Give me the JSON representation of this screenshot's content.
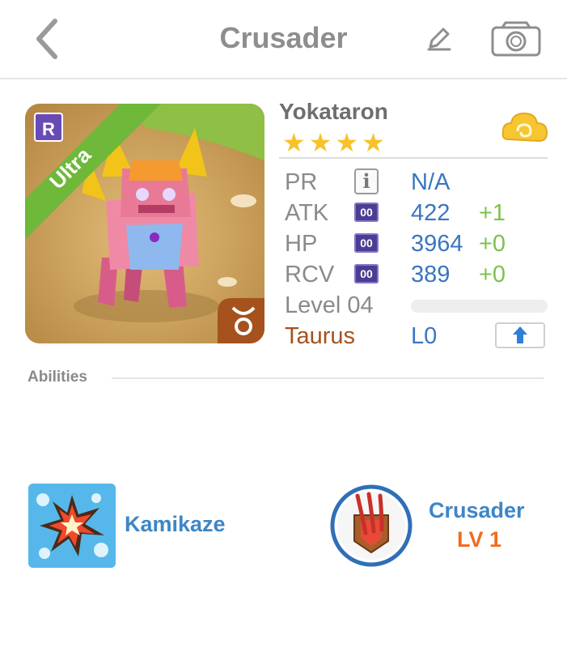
{
  "header": {
    "title": "Crusader",
    "back_icon": "chevron-left-icon",
    "edit_icon": "pencil-icon",
    "camera_icon": "camera-icon"
  },
  "monster": {
    "name": "Yokataron",
    "rarity_label": "Ultra",
    "rarity_badge": "R",
    "star_count": 4,
    "stars": "★★★★",
    "element_icon": "cloud-icon",
    "zodiac_icon": "taurus-icon"
  },
  "stats": {
    "pr": {
      "label": "PR",
      "badge": "i",
      "value": "N/A"
    },
    "atk": {
      "label": "ATK",
      "badge": "00",
      "value": "422",
      "bonus": "+1"
    },
    "hp": {
      "label": "HP",
      "badge": "00",
      "value": "3964",
      "bonus": "+0"
    },
    "rcv": {
      "label": "RCV",
      "badge": "00",
      "value": "389",
      "bonus": "+0"
    },
    "level": {
      "label": "Level 04",
      "progress": 0.0
    },
    "sign": {
      "label": "Taurus",
      "value": "L0",
      "upgrade_icon": "arrow-up-icon"
    }
  },
  "abilities": {
    "heading": "Abilities",
    "active": {
      "name": "Kamikaze",
      "icon": "explosion-icon"
    },
    "leader": {
      "name": "Crusader",
      "level": "LV 1",
      "icon": "claw-shield-icon"
    }
  },
  "colors": {
    "value_blue": "#3a76c0",
    "bonus_green": "#7cc24c",
    "zodiac_brown": "#a5521e",
    "star_yellow": "#f7c22a",
    "rarity_green": "#6fb83a",
    "rarity_purple": "#6a4bb5",
    "leader_level_orange": "#f26b1e"
  }
}
